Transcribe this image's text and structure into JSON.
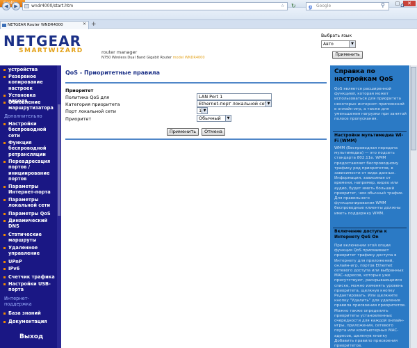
{
  "browser": {
    "app_button": "Firefox",
    "url": "wndr4000/start.htm",
    "search_placeholder": "Google",
    "tab_title": "NETGEAR Router WNDR4000",
    "new_tab": "+",
    "win_min": "–",
    "win_max": "□",
    "win_close": "✕"
  },
  "header": {
    "logo_main": "NETGEAR",
    "logo_sub": "SMARTWIZARD",
    "product": "router manager",
    "product_sub": "N750 Wireless Dual Band Gigabit Router",
    "model": "model WNDR4000",
    "lang_label": "Выбрать язык",
    "lang_value": "Авто",
    "apply_label": "Применить"
  },
  "sidebar": {
    "items": [
      "устройства",
      "Резервное копирование настроек",
      "Установка пароля",
      "Обновление маршрутизатора",
      "Дополнительно",
      "Настройки беспроводной сети",
      "Функция беспроводной ретрансляции",
      "Переадресация портов / инициирование портов",
      "Параметры Интернет-порта",
      "Параметры локальной сети",
      "Параметры QoS",
      "Динамический DNS",
      "Статические маршруты",
      "Удаленное управление",
      "UPnP",
      "IPv6",
      "Счетчик трафика",
      "Настройки USB-порта",
      "Интернет-поддержка",
      "База знаний",
      "Документация",
      "Выход"
    ]
  },
  "main": {
    "title": "QoS - Приоритетные правила",
    "section": "Приоритет",
    "fields": {
      "policy_label": "Политика QoS для",
      "policy_value": "LAN Port 1",
      "category_label": "Категория приоритета",
      "category_value": "Ethernet-порт локальной сети",
      "port_label": "Порт локальной сети",
      "port_value": "1",
      "priority_label": "Приоритет",
      "priority_value": "Обычный"
    },
    "apply_label": "Применить",
    "cancel_label": "Отмена"
  },
  "help": {
    "title": "Справка по настройкам QoS",
    "intro": "QoS является расширенной функцией, которая может использоваться для приоритета некоторых интернет-приложений в онлайн-игр, а также для уменьшения нагрузки при занятой полосе пропускания.",
    "wmm_title": "Настройки мультимедиа Wi-Fi (WMM)",
    "wmm_text": "WMM (Беспроводная передача мультимедиа) — это подсеть стандарта 802.11e. WMM предоставляет беспроводному трафику ряд приоритетов, в зависимости от вида данных. Информация, зависимая от времени, например, видео или аудио, будет иметь больший приоритет, чем обычный трафик. Для правильного функционирования WMM беспроводные клиенты должны иметь поддержку WMM.",
    "ishare_title": "Включение доступа к Интернету QoS On",
    "ishare_text": "При включении этой опции функция QoS присваивает приоритет трафику доступа в Интернету для приложений, онлайн-игр, портов Ethernet сетевого доступа или выбранных MAC-адресов, которые уже присутствуют, раскрывающемся списке, можно изменять уровень приоритета, щелкнув кнопку Редактировать. Или щелкните кнопку \"Удалить\" для удаления правила присвоения приоритетов. Можно также определить приоритеты установленных очередности для каждой онлайн-игры, приложения, сетевого порта или компьютерных MAC-адресов, щелкнув кнопку Добавить правило присвоения приоритетов."
  }
}
